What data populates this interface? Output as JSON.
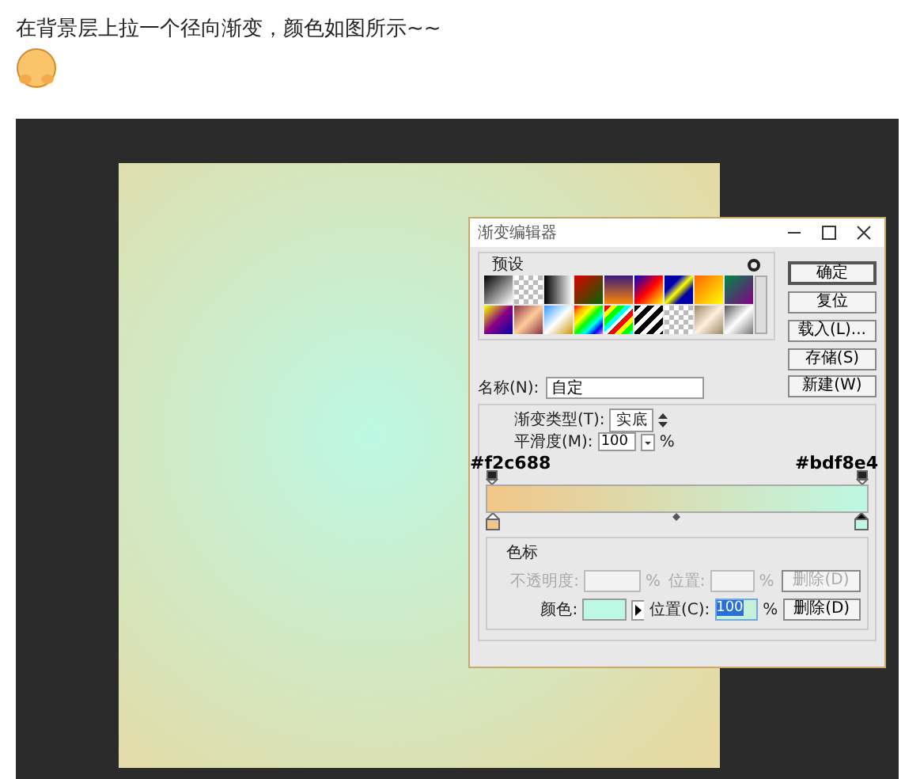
{
  "post": {
    "text": "在背景层上拉一个径向渐变，颜色如图所示~~"
  },
  "dialog": {
    "title": "渐变编辑器",
    "presets_label": "预设",
    "buttons": [
      {
        "label": "确定",
        "kind": "default"
      },
      {
        "label": "复位",
        "kind": "normal"
      },
      {
        "label": "载入(L)...",
        "kind": "normal"
      },
      {
        "label": "存储(S)",
        "kind": "normal"
      }
    ],
    "name_label": "名称(N):",
    "name_value": "自定",
    "new_button": "新建(W)",
    "type_label": "渐变类型(T):",
    "type_value": "实底",
    "smoothness_label": "平滑度(M):",
    "smoothness_value": "100",
    "smoothness_unit": "%",
    "annotations": [
      {
        "text": "#f2c688"
      },
      {
        "text": "#bdf8e4"
      }
    ],
    "stops": [
      {
        "color": "#f2c688",
        "selected": false
      },
      {
        "color": "#bdf8e4",
        "selected": true
      }
    ],
    "color_stops": {
      "label": "色标",
      "opacity_disabled": true,
      "opacity_label": "不透明度:",
      "opacity_unit": "%",
      "opacity_position_label": "位置:",
      "opacity_position_unit": "%",
      "opacity_delete": "删除(D)",
      "color_label": "颜色:",
      "position_label": "位置(C):",
      "position_value": "100",
      "position_unit": "%",
      "delete": "删除(D)"
    }
  }
}
